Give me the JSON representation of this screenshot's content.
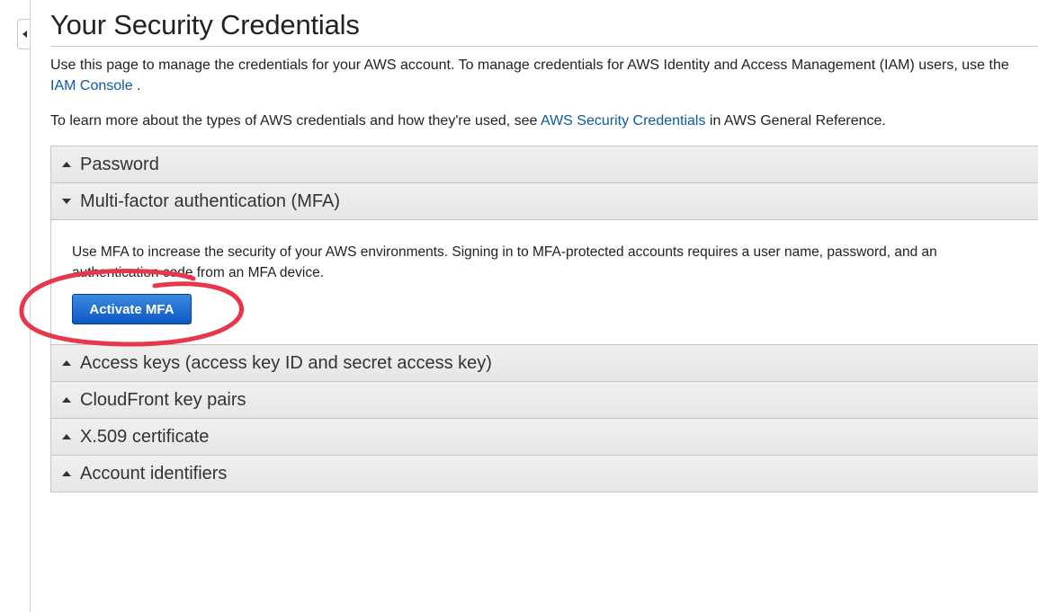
{
  "page": {
    "title": "Your Security Credentials",
    "intro_text": "Use this page to manage the credentials for your AWS account. To manage credentials for AWS Identity and Access Management (IAM) users, use the ",
    "iam_console_link": "IAM Console",
    "intro_text_end": " .",
    "learn_more_text": "To learn more about the types of AWS credentials and how they're used, see ",
    "security_credentials_link": "AWS Security Credentials",
    "learn_more_end": " in AWS General Reference."
  },
  "sections": {
    "password": {
      "label": "Password",
      "state": "collapsed"
    },
    "mfa": {
      "label": "Multi-factor authentication (MFA)",
      "state": "expanded",
      "description": "Use MFA to increase the security of your AWS environments. Signing in to MFA-protected accounts requires a user name, password, and an authentication code from an MFA device.",
      "button_label": "Activate MFA"
    },
    "access_keys": {
      "label": "Access keys (access key ID and secret access key)",
      "state": "collapsed"
    },
    "cloudfront": {
      "label": "CloudFront key pairs",
      "state": "collapsed"
    },
    "x509": {
      "label": "X.509 certificate",
      "state": "collapsed"
    },
    "account_ids": {
      "label": "Account identifiers",
      "state": "collapsed"
    }
  },
  "colors": {
    "link": "#0a5aa8",
    "button": "#1a66cc",
    "annotation": "#e8364a"
  },
  "icons": {
    "collapse_nav": "chevron-left-icon",
    "collapsed_section": "caret-up-icon",
    "expanded_section": "caret-down-icon"
  }
}
